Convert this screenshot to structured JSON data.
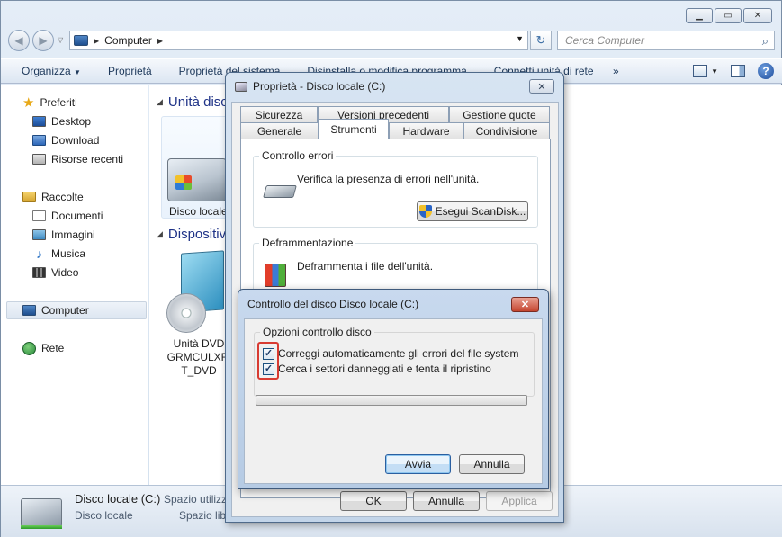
{
  "explorer": {
    "address": {
      "location": "Computer"
    },
    "search": {
      "placeholder": "Cerca Computer"
    },
    "commands": [
      "Organizza",
      "Proprietà",
      "Proprietà del sistema",
      "Disinstalla o modifica programma",
      "Connetti unità di rete"
    ],
    "more": "»",
    "sidebar": {
      "favorites": {
        "label": "Preferiti",
        "items": [
          "Desktop",
          "Download",
          "Risorse recenti"
        ]
      },
      "libraries": {
        "label": "Raccolte",
        "items": [
          "Documenti",
          "Immagini",
          "Musica",
          "Video"
        ]
      },
      "computer": "Computer",
      "network": "Rete"
    },
    "groups": {
      "hard_disks": "Unità disco",
      "removable": "Dispositivi"
    },
    "items": {
      "local_disk": "Disco locale",
      "dvd_line1": "Unità DVD",
      "dvd_line2": "GRMCULXFI",
      "dvd_line3": "T_DVD"
    },
    "details": {
      "name": "Disco locale (C:)",
      "type": "Disco locale",
      "free_label": "Spazio utilizz",
      "total_label": "Spazio libe"
    }
  },
  "properties_dialog": {
    "title": "Proprietà - Disco locale (C:)",
    "close": "✕",
    "tabs_row1": [
      "Sicurezza",
      "Versioni precedenti",
      "Gestione quote"
    ],
    "tabs_row2": [
      "Generale",
      "Strumenti",
      "Hardware",
      "Condivisione"
    ],
    "active_tab": "Strumenti",
    "error_check": {
      "group": "Controllo errori",
      "description": "Verifica la presenza di errori nell'unità.",
      "button": "Esegui ScanDisk..."
    },
    "defrag": {
      "group": "Deframmentazione",
      "description": "Deframmenta i file dell'unità."
    },
    "buttons": {
      "ok": "OK",
      "cancel": "Annulla",
      "apply": "Applica"
    }
  },
  "checkdisk_dialog": {
    "title": "Controllo del disco Disco locale (C:)",
    "close": "✕",
    "group": "Opzioni controllo disco",
    "options": [
      {
        "label": "Correggi automaticamente gli errori del file system",
        "checked": true
      },
      {
        "label": "Cerca i settori danneggiati e tenta il ripristino",
        "checked": true
      }
    ],
    "progress": 0,
    "buttons": {
      "start": "Avvia",
      "cancel": "Annulla"
    },
    "colors": {
      "highlight": "#d83b32"
    }
  }
}
